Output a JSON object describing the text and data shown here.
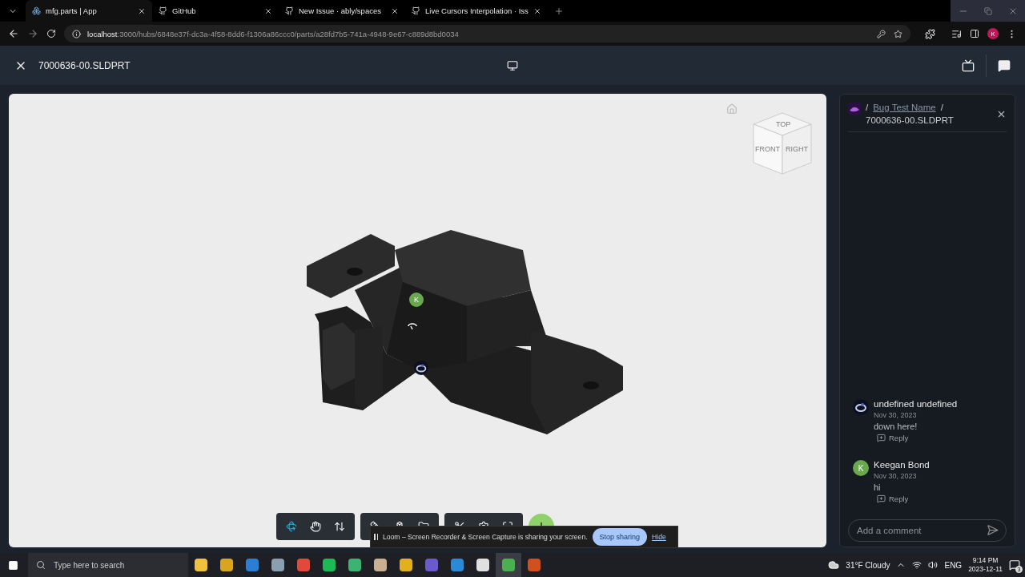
{
  "browser": {
    "tabs": [
      {
        "title": "mfg.parts | App",
        "selected": true,
        "kind": "app"
      },
      {
        "title": "GitHub",
        "selected": false,
        "kind": "github"
      },
      {
        "title": "New Issue · ably/spaces",
        "selected": false,
        "kind": "github"
      },
      {
        "title": "Live Cursors Interpolation · Iss",
        "selected": false,
        "kind": "github"
      }
    ],
    "url_host": "localhost",
    "url_path": ":3000/hubs/6848e37f-dc3a-4f58-8dd6-f1306a86ccc0/parts/a28fd7b5-741a-4948-9e67-c889d8bd0034",
    "profile_initial": "K"
  },
  "app_header": {
    "file_name": "7000636-00.SLDPRT"
  },
  "viewer": {
    "viewcube": [
      "TOP",
      "FRONT",
      "RIGHT"
    ],
    "cursors": [
      {
        "kind": "initial",
        "initial": "K",
        "color": "#6aa84f"
      },
      {
        "kind": "image"
      }
    ],
    "toolbar_groups": [
      [
        {
          "kind": "orbit",
          "selected": true
        },
        {
          "kind": "pan",
          "selected": false
        },
        {
          "kind": "zoom",
          "selected": false
        }
      ],
      [
        {
          "kind": "measure",
          "selected": false
        },
        {
          "kind": "explode",
          "selected": false
        },
        {
          "kind": "folder",
          "selected": false
        }
      ],
      [
        {
          "kind": "section",
          "selected": false
        },
        {
          "kind": "settings",
          "selected": false
        },
        {
          "kind": "fullscreen",
          "selected": false
        }
      ]
    ]
  },
  "panel": {
    "breadcrumb": "Bug Test Name",
    "breadcrumb_separators": [
      "/",
      "/"
    ],
    "file_name": "7000636-00.SLDPRT",
    "comments": [
      {
        "author": "undefined undefined",
        "date": "Nov 30, 2023",
        "text": "down here!",
        "reply_label": "Reply",
        "avatar": {
          "kind": "image"
        }
      },
      {
        "author": "Keegan Bond",
        "date": "Nov 30, 2023",
        "text": "hi",
        "reply_label": "Reply",
        "avatar": {
          "kind": "initial",
          "initial": "K",
          "color": "#6aa84f"
        }
      }
    ],
    "comment_placeholder": "Add a comment"
  },
  "share_bar": {
    "message": "Loom – Screen Recorder & Screen Capture is sharing your screen.",
    "stop_label": "Stop sharing",
    "hide_label": "Hide"
  },
  "taskbar": {
    "search_placeholder": "Type here to search",
    "apps": [
      {
        "color": "#f0c040",
        "selected": false
      },
      {
        "color": "#d9a520",
        "selected": false
      },
      {
        "color": "#2a7fd4",
        "selected": false
      },
      {
        "color": "#8aa0b0",
        "selected": false
      },
      {
        "color": "#e04a3a",
        "selected": false
      },
      {
        "color": "#1db954",
        "selected": false
      },
      {
        "color": "#3cb371",
        "selected": false
      },
      {
        "color": "#c8b090",
        "selected": false
      },
      {
        "color": "#e0b020",
        "selected": false
      },
      {
        "color": "#6a5acd",
        "selected": false
      },
      {
        "color": "#2a8ad8",
        "selected": false
      },
      {
        "color": "#e0e0e0",
        "selected": false
      },
      {
        "color": "#4caf50",
        "selected": true
      },
      {
        "color": "#d05020",
        "selected": false
      }
    ],
    "weather": "31°F Cloudy",
    "language": "ENG",
    "time": "9:14 PM",
    "date": "2023-12-11",
    "notifications": "3"
  }
}
